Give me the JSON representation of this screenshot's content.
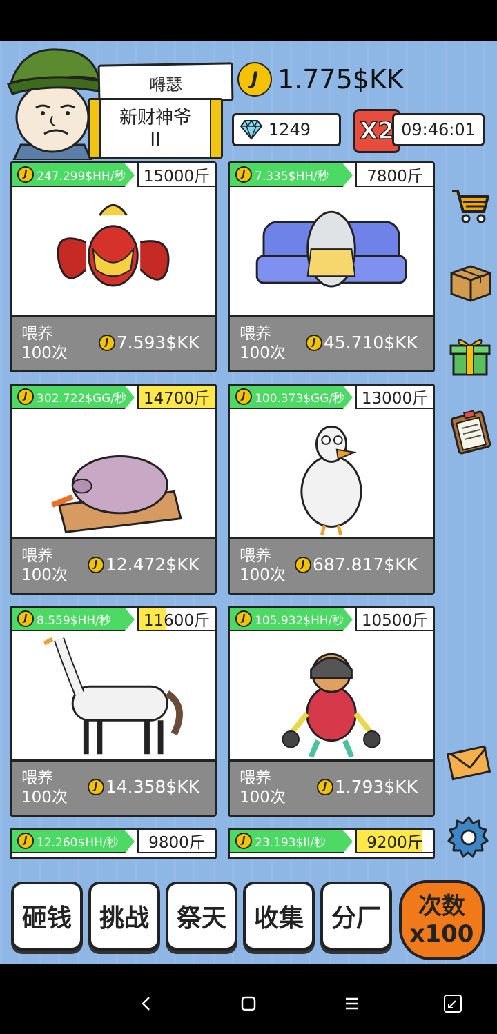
{
  "player": {
    "name": "嘚瑟",
    "rank": "新财神爷",
    "rank_level": "II",
    "money": "1.775$KK",
    "gems": "1249",
    "multiplier": "X2",
    "timer": "09:46:01"
  },
  "cards": [
    {
      "rate": "247.299$HH/秒",
      "weight": "15000斤",
      "weight_fill": 0.0,
      "feed_label_1": "喂养",
      "feed_label_2": "100次",
      "price": "7.593$KK",
      "animal": "crayfish-icon"
    },
    {
      "rate": "7.335$HH/秒",
      "weight": "7800斤",
      "weight_fill": 0.0,
      "feed_label_1": "喂养",
      "feed_label_2": "100次",
      "price": "45.710$KK",
      "animal": "salted-fish-icon"
    },
    {
      "rate": "302.722$GG/秒",
      "weight": "14700斤",
      "weight_fill": 1.0,
      "feed_label_1": "喂养",
      "feed_label_2": "100次",
      "price": "12.472$KK",
      "animal": "pig-icon"
    },
    {
      "rate": "100.373$GG/秒",
      "weight": "13000斤",
      "weight_fill": 0.0,
      "feed_label_1": "喂养",
      "feed_label_2": "100次",
      "price": "687.817$KK",
      "animal": "goose-icon"
    },
    {
      "rate": "8.559$HH/秒",
      "weight": "11600斤",
      "weight_fill": 0.35,
      "feed_label_1": "喂养",
      "feed_label_2": "100次",
      "price": "14.358$KK",
      "animal": "goose-horse-icon"
    },
    {
      "rate": "105.932$HH/秒",
      "weight": "10500斤",
      "weight_fill": 0.0,
      "feed_label_1": "喂养",
      "feed_label_2": "100次",
      "price": "1.793$KK",
      "animal": "monkey-soldier-icon"
    },
    {
      "rate": "12.260$HH/秒",
      "weight": "9800斤",
      "weight_fill": 0.0,
      "animal": ""
    },
    {
      "rate": "23.193$II/秒",
      "weight": "9200斤",
      "weight_fill": 0.85,
      "animal": ""
    }
  ],
  "side_icons": [
    "shop-cart-icon",
    "box-icon",
    "gift-icon",
    "clipboard-icon",
    "mail-icon",
    "settings-gear-icon"
  ],
  "buttons": {
    "b1": "砸钱",
    "b2": "挑战",
    "b3": "祭天",
    "b4": "收集",
    "b5": "分厂",
    "count_line1": "次数",
    "count_line2": "x100"
  },
  "colors": {
    "background": "#8fb7e6",
    "rate_green": "#4cd964",
    "coin": "#f4c200",
    "count_button": "#f07a1a"
  }
}
